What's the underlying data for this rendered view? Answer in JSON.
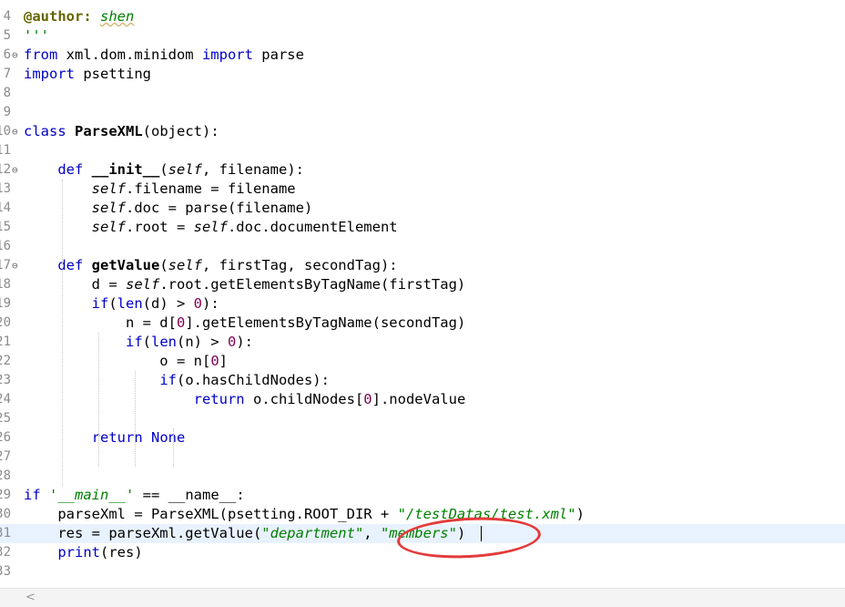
{
  "editor": {
    "lines": [
      {
        "n": "4",
        "fold": "",
        "tokens": [
          {
            "t": "@author: ",
            "c": "dec"
          },
          {
            "t": "shen",
            "c": "str under"
          }
        ]
      },
      {
        "n": "5",
        "fold": "",
        "tokens": [
          {
            "t": "'''",
            "c": "doc"
          }
        ]
      },
      {
        "n": "6",
        "fold": "⊖",
        "tokens": [
          {
            "t": "from",
            "c": "kw"
          },
          {
            "t": " xml.dom.minidom ",
            "c": ""
          },
          {
            "t": "import",
            "c": "kw"
          },
          {
            "t": " parse",
            "c": ""
          }
        ]
      },
      {
        "n": "7",
        "fold": "",
        "tokens": [
          {
            "t": "import",
            "c": "kw"
          },
          {
            "t": " psetting",
            "c": ""
          }
        ]
      },
      {
        "n": "8",
        "fold": "",
        "tokens": []
      },
      {
        "n": "9",
        "fold": "",
        "tokens": []
      },
      {
        "n": "10",
        "fold": "⊖",
        "tokens": [
          {
            "t": "class",
            "c": "kw"
          },
          {
            "t": " ",
            "c": ""
          },
          {
            "t": "ParseXML",
            "c": "fn"
          },
          {
            "t": "(object):",
            "c": ""
          }
        ]
      },
      {
        "n": "11",
        "fold": "",
        "tokens": []
      },
      {
        "n": "12",
        "fold": "⊖",
        "tokens": [
          {
            "t": "    ",
            "c": ""
          },
          {
            "t": "def",
            "c": "kw"
          },
          {
            "t": " ",
            "c": ""
          },
          {
            "t": "__init__",
            "c": "fn"
          },
          {
            "t": "(",
            "c": ""
          },
          {
            "t": "self",
            "c": "self"
          },
          {
            "t": ", filename):",
            "c": ""
          }
        ]
      },
      {
        "n": "13",
        "fold": "",
        "tokens": [
          {
            "t": "        ",
            "c": ""
          },
          {
            "t": "self",
            "c": "self"
          },
          {
            "t": ".filename = filename",
            "c": ""
          }
        ]
      },
      {
        "n": "14",
        "fold": "",
        "tokens": [
          {
            "t": "        ",
            "c": ""
          },
          {
            "t": "self",
            "c": "self"
          },
          {
            "t": ".doc = parse(filename)",
            "c": ""
          }
        ]
      },
      {
        "n": "15",
        "fold": "",
        "tokens": [
          {
            "t": "        ",
            "c": ""
          },
          {
            "t": "self",
            "c": "self"
          },
          {
            "t": ".root = ",
            "c": ""
          },
          {
            "t": "self",
            "c": "self"
          },
          {
            "t": ".doc.documentElement",
            "c": ""
          }
        ]
      },
      {
        "n": "16",
        "fold": "",
        "tokens": []
      },
      {
        "n": "17",
        "fold": "⊖",
        "tokens": [
          {
            "t": "    ",
            "c": ""
          },
          {
            "t": "def",
            "c": "kw"
          },
          {
            "t": " ",
            "c": ""
          },
          {
            "t": "getValue",
            "c": "fn"
          },
          {
            "t": "(",
            "c": ""
          },
          {
            "t": "self",
            "c": "self"
          },
          {
            "t": ", firstTag, secondTag):",
            "c": ""
          }
        ]
      },
      {
        "n": "18",
        "fold": "",
        "tokens": [
          {
            "t": "        d = ",
            "c": ""
          },
          {
            "t": "self",
            "c": "self"
          },
          {
            "t": ".root.getElementsByTagName(firstTag)",
            "c": ""
          }
        ]
      },
      {
        "n": "19",
        "fold": "",
        "tokens": [
          {
            "t": "        ",
            "c": ""
          },
          {
            "t": "if",
            "c": "kw"
          },
          {
            "t": "(",
            "c": ""
          },
          {
            "t": "len",
            "c": "kw"
          },
          {
            "t": "(d) > ",
            "c": ""
          },
          {
            "t": "0",
            "c": "num"
          },
          {
            "t": "):",
            "c": ""
          }
        ]
      },
      {
        "n": "20",
        "fold": "",
        "tokens": [
          {
            "t": "            n = d[",
            "c": ""
          },
          {
            "t": "0",
            "c": "num"
          },
          {
            "t": "].getElementsByTagName(secondTag)",
            "c": ""
          }
        ]
      },
      {
        "n": "21",
        "fold": "",
        "tokens": [
          {
            "t": "            ",
            "c": ""
          },
          {
            "t": "if",
            "c": "kw"
          },
          {
            "t": "(",
            "c": ""
          },
          {
            "t": "len",
            "c": "kw"
          },
          {
            "t": "(n) > ",
            "c": ""
          },
          {
            "t": "0",
            "c": "num"
          },
          {
            "t": "):",
            "c": ""
          }
        ]
      },
      {
        "n": "22",
        "fold": "",
        "tokens": [
          {
            "t": "                o = n[",
            "c": ""
          },
          {
            "t": "0",
            "c": "num"
          },
          {
            "t": "]",
            "c": ""
          }
        ]
      },
      {
        "n": "23",
        "fold": "",
        "tokens": [
          {
            "t": "                ",
            "c": ""
          },
          {
            "t": "if",
            "c": "kw"
          },
          {
            "t": "(o.hasChildNodes):",
            "c": ""
          }
        ]
      },
      {
        "n": "24",
        "fold": "",
        "tokens": [
          {
            "t": "                    ",
            "c": ""
          },
          {
            "t": "return",
            "c": "kw"
          },
          {
            "t": " o.childNodes[",
            "c": ""
          },
          {
            "t": "0",
            "c": "num"
          },
          {
            "t": "].nodeValue",
            "c": ""
          }
        ]
      },
      {
        "n": "25",
        "fold": "",
        "tokens": []
      },
      {
        "n": "26",
        "fold": "",
        "tokens": [
          {
            "t": "        ",
            "c": ""
          },
          {
            "t": "return",
            "c": "kw"
          },
          {
            "t": " ",
            "c": ""
          },
          {
            "t": "None",
            "c": "kw"
          }
        ]
      },
      {
        "n": "27",
        "fold": "",
        "tokens": []
      },
      {
        "n": "28",
        "fold": "",
        "tokens": []
      },
      {
        "n": "29",
        "fold": "",
        "tokens": [
          {
            "t": "if",
            "c": "kw"
          },
          {
            "t": " ",
            "c": ""
          },
          {
            "t": "'__main__'",
            "c": "str"
          },
          {
            "t": " == __name__:",
            "c": ""
          }
        ]
      },
      {
        "n": "30",
        "fold": "",
        "tokens": [
          {
            "t": "    parseXml = ParseXML(psetting.ROOT_DIR + ",
            "c": ""
          },
          {
            "t": "\"/testDatas/test.xml\"",
            "c": "str"
          },
          {
            "t": ")",
            "c": ""
          }
        ]
      },
      {
        "n": "31",
        "fold": "",
        "current": true,
        "tokens": [
          {
            "t": "    res = parseXml.getValue(",
            "c": ""
          },
          {
            "t": "\"department\"",
            "c": "str"
          },
          {
            "t": ", ",
            "c": ""
          },
          {
            "t": "\"members\"",
            "c": "str"
          },
          {
            "t": ")",
            "c": ""
          }
        ]
      },
      {
        "n": "32",
        "fold": "",
        "tokens": [
          {
            "t": "    ",
            "c": ""
          },
          {
            "t": "print",
            "c": "kw"
          },
          {
            "t": "(res)",
            "c": ""
          }
        ]
      },
      {
        "n": "33",
        "fold": "",
        "tokens": []
      }
    ]
  },
  "scrollbar": {
    "left_arrow": "<"
  }
}
